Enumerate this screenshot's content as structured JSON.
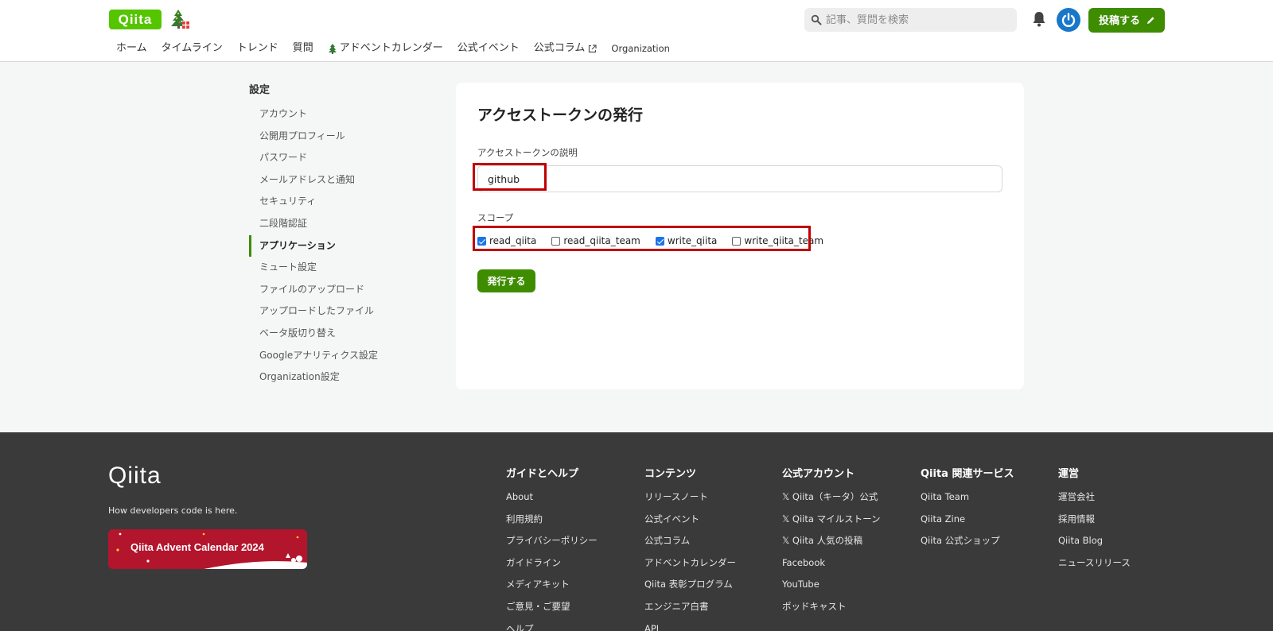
{
  "header": {
    "logo": "Qiita",
    "search_placeholder": "記事、質問を検索",
    "post_button": "投稿する",
    "nav": [
      "ホーム",
      "タイムライン",
      "トレンド",
      "質問",
      "アドベントカレンダー",
      "公式イベント",
      "公式コラム",
      "Organization"
    ]
  },
  "sidebar": {
    "title": "設定",
    "items": [
      "アカウント",
      "公開用プロフィール",
      "パスワード",
      "メールアドレスと通知",
      "セキュリティ",
      "二段階認証",
      "アプリケーション",
      "ミュート設定",
      "ファイルのアップロード",
      "アップロードしたファイル",
      "ベータ版切り替え",
      "Googleアナリティクス設定",
      "Organization設定"
    ],
    "active": "アプリケーション"
  },
  "form": {
    "title": "アクセストークンの発行",
    "desc_label": "アクセストークンの説明",
    "desc_value": "github",
    "scope_label": "スコープ",
    "scopes": [
      {
        "name": "read_qiita",
        "checked": true
      },
      {
        "name": "read_qiita_team",
        "checked": false
      },
      {
        "name": "write_qiita",
        "checked": true
      },
      {
        "name": "write_qiita_team",
        "checked": false
      }
    ],
    "submit": "発行する"
  },
  "footer": {
    "logo": "Qiita",
    "tagline": "How developers code is here.",
    "banner": "Qiita Advent Calendar 2024",
    "columns": [
      {
        "title": "ガイドとヘルプ",
        "links": [
          "About",
          "利用規約",
          "プライバシーポリシー",
          "ガイドライン",
          "メディアキット",
          "ご意見・ご要望",
          "ヘルプ"
        ]
      },
      {
        "title": "コンテンツ",
        "links": [
          "リリースノート",
          "公式イベント",
          "公式コラム",
          "アドベントカレンダー",
          "Qiita 表彰プログラム",
          "エンジニア白書",
          "API"
        ]
      },
      {
        "title": "公式アカウント",
        "links": [
          "𝕏 Qiita（キータ）公式",
          "𝕏 Qiita マイルストーン",
          "𝕏 Qiita 人気の投稿",
          "Facebook",
          "YouTube",
          "ポッドキャスト"
        ]
      },
      {
        "title": "Qiita 関連サービス",
        "links": [
          "Qiita Team",
          "Qiita Zine",
          "Qiita 公式ショップ"
        ]
      },
      {
        "title": "運営",
        "links": [
          "運営会社",
          "採用情報",
          "Qiita Blog",
          "ニュースリリース"
        ]
      }
    ]
  },
  "colors": {
    "brand": "#55c500",
    "button": "#3e8c00",
    "highlight": "#c00000",
    "footer": "#3a3a3a"
  }
}
